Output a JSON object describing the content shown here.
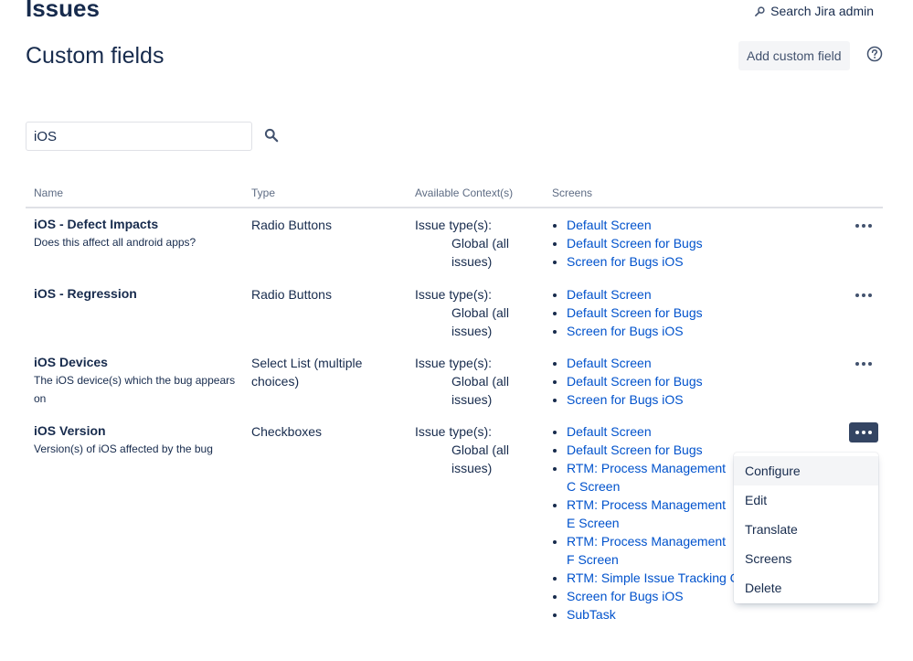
{
  "header": {
    "section_title": "Issues",
    "search_admin_label": "Search Jira admin",
    "page_title": "Custom fields",
    "add_button_label": "Add custom field"
  },
  "filter": {
    "value": "iOS"
  },
  "table": {
    "columns": [
      "Name",
      "Type",
      "Available Context(s)",
      "Screens"
    ],
    "rows": [
      {
        "name": "iOS - Defect Impacts",
        "description": "Does this affect all android apps?",
        "type": "Radio Buttons",
        "context_label": "Issue type(s):",
        "context_value": "Global (all issues)",
        "screens": [
          "Default Screen",
          "Default Screen for Bugs",
          "Screen for Bugs iOS"
        ]
      },
      {
        "name": "iOS - Regression",
        "description": "",
        "type": "Radio Buttons",
        "context_label": "Issue type(s):",
        "context_value": "Global (all issues)",
        "screens": [
          "Default Screen",
          "Default Screen for Bugs",
          "Screen for Bugs iOS"
        ]
      },
      {
        "name": "iOS Devices",
        "description": "The iOS device(s) which the bug appears on",
        "type": "Select List (multiple choices)",
        "context_label": "Issue type(s):",
        "context_value": "Global (all issues)",
        "screens": [
          "Default Screen",
          "Default Screen for Bugs",
          "Screen for Bugs iOS"
        ]
      },
      {
        "name": "iOS Version",
        "description": "Version(s) of iOS affected by the bug",
        "type": "Checkboxes",
        "context_label": "Issue type(s):",
        "context_value": "Global (all issues)",
        "screens": [
          "Default Screen",
          "Default Screen for Bugs",
          "RTM: Process Management C Screen",
          "RTM: Process Management E Screen",
          "RTM: Process Management F Screen",
          "RTM: Simple Issue Tracking C",
          "Screen for Bugs iOS",
          "SubTask"
        ]
      }
    ]
  },
  "menu": {
    "items": [
      "Configure",
      "Edit",
      "Translate",
      "Screens",
      "Delete"
    ]
  }
}
